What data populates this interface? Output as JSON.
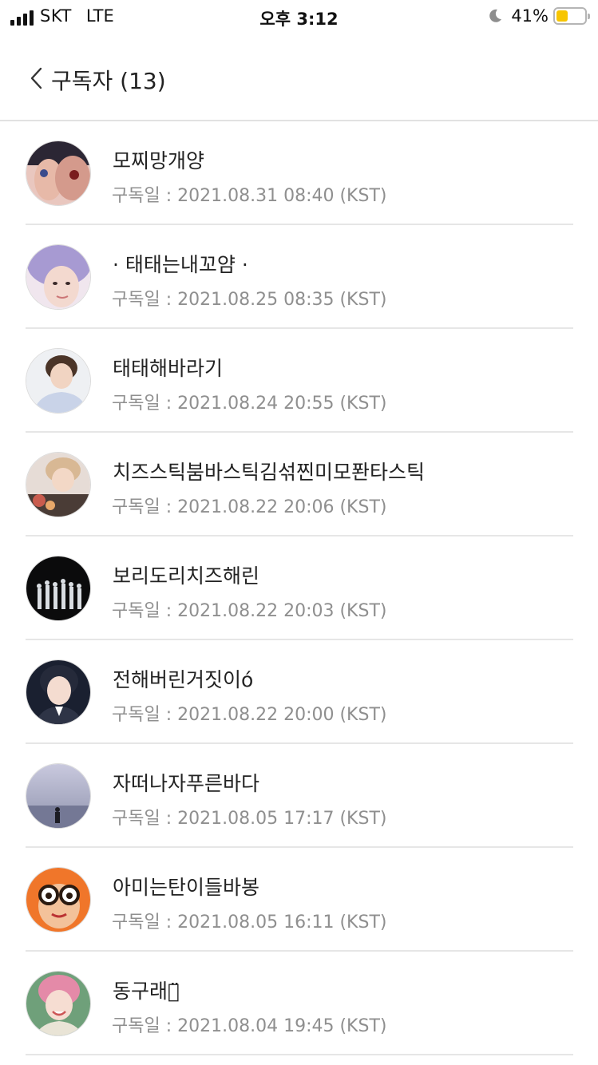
{
  "status_bar": {
    "carrier": "SKT",
    "network": "LTE",
    "time": "오후 3:12",
    "battery_percent": "41%",
    "battery_level": 0.41,
    "battery_color": "#f7c500"
  },
  "header": {
    "back_icon": "chevron-left-icon",
    "title": "구독자 (13)"
  },
  "subscribers": [
    {
      "name": "모찌망개양",
      "date": "구독일 : 2021.08.31 08:40 (KST)"
    },
    {
      "name": "· 태태는내꼬얌 ·",
      "date": "구독일 : 2021.08.25 08:35 (KST)"
    },
    {
      "name": "태태해바라기",
      "date": "구독일 : 2021.08.24 20:55 (KST)"
    },
    {
      "name": "치즈스틱붐바스틱김섞찐미모퐌타스틱",
      "date": "구독일 : 2021.08.22 20:06 (KST)"
    },
    {
      "name": "보리도리치즈해린",
      "date": "구독일 : 2021.08.22 20:03 (KST)"
    },
    {
      "name": "전해버린거짓이ό",
      "date": "구독일 : 2021.08.22 20:00 (KST)"
    },
    {
      "name": "자떠나자푸른바다",
      "date": "구독일 : 2021.08.05 17:17 (KST)"
    },
    {
      "name": "아미는탄이들바봉",
      "date": "구독일 : 2021.08.05 16:11 (KST)"
    },
    {
      "name": "동구래미̈",
      "date": "구독일 : 2021.08.04 19:45 (KST)"
    }
  ]
}
